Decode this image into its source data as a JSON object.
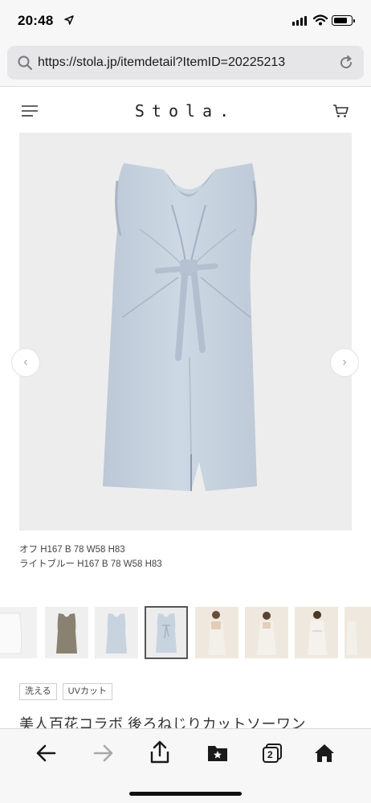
{
  "status_bar": {
    "time": "20:48",
    "icons": [
      "location-arrow-icon",
      "signal-icon",
      "wifi-icon",
      "battery-icon"
    ]
  },
  "browser": {
    "url": "https://stola.jp/itemdetail?ItemID=20225213",
    "icons": [
      "search-icon",
      "reload-icon"
    ]
  },
  "site": {
    "logo": "Stola.",
    "icons": [
      "hamburger-menu-icon",
      "cart-icon"
    ]
  },
  "gallery": {
    "prev_icon": "‹",
    "next_icon": "›",
    "main_image": "light-blue sleeveless dress with front twist tie",
    "thumbnails": [
      {
        "name": "white-dress-partial"
      },
      {
        "name": "khaki-dress"
      },
      {
        "name": "light-blue-dress"
      },
      {
        "name": "light-blue-dress-back",
        "selected": true
      },
      {
        "name": "model-back-view"
      },
      {
        "name": "model-back-view-2"
      },
      {
        "name": "model-front-view"
      },
      {
        "name": "model-partial"
      }
    ]
  },
  "caption": {
    "line1": "オフ H167 B 78 W58 H83",
    "line2": "ライトブルー H167 B 78 W58 H83"
  },
  "tags": [
    "洗える",
    "UVカット"
  ],
  "product": {
    "title": "美人百花コラボ 後ろねじりカットソーワン"
  },
  "toolbar": {
    "icons": [
      "back-arrow-icon",
      "forward-arrow-icon",
      "share-icon",
      "bookmarks-icon",
      "tabs-icon",
      "home-icon"
    ],
    "tab_count": "2"
  },
  "colors": {
    "dress": "#c8d3e0",
    "image_bg": "#ededed",
    "chrome_bg": "#f7f7f7"
  }
}
